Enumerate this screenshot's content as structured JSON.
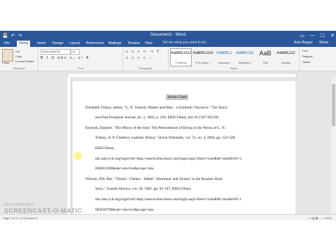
{
  "window": {
    "title": "Document1 - Word",
    "min": "—",
    "max": "☐",
    "close": "✕",
    "ribbon_opts": "▭"
  },
  "qat": {
    "save": "💾",
    "undo": "↶",
    "redo": "↷"
  },
  "tabs": [
    {
      "label": "File"
    },
    {
      "label": "Home"
    },
    {
      "label": "Insert"
    },
    {
      "label": "Design"
    },
    {
      "label": "Layout"
    },
    {
      "label": "References"
    },
    {
      "label": "Mailings"
    },
    {
      "label": "Review"
    },
    {
      "label": "View"
    }
  ],
  "tellme": "Tell me what you want to do...",
  "user": "Amy Burger",
  "share": "Share",
  "ribbon": {
    "clipboard": {
      "paste": "Paste",
      "cut": "Cut",
      "copy": "Copy",
      "painter": "Format Painter",
      "label": "Clipboard"
    },
    "font": {
      "name": "Times New Ro",
      "size": "12",
      "row": "B I U abc x₂ x² A",
      "label": "Font"
    },
    "paragraph": {
      "row1": "≡ ≡ ≡ ⇤ ⇥ ¶",
      "row2": "≡ ≡ ≡ ≡ ↕",
      "label": "Paragraph"
    },
    "styles": [
      {
        "sample": "AaBbCcDc",
        "name": "¶ Normal",
        "active": true
      },
      {
        "sample": "AaBbCcDc",
        "name": "¶ No Spac..."
      },
      {
        "sample": "AaBbCc",
        "name": "Heading 1"
      },
      {
        "sample": "AaBbCcE",
        "name": "Heading 2"
      },
      {
        "sample": "AaB",
        "name": "Title"
      },
      {
        "sample": "AaBbCcD",
        "name": "Subtitle"
      }
    ],
    "styles_label": "Styles",
    "editing": {
      "find": "Find",
      "replace": "Replace",
      "select": "Select",
      "label": "Editing"
    }
  },
  "document": {
    "heading": "Works Cited",
    "lines": [
      "Elizabeth Trahan, author. \"L. N. Tolstoj's Master and Man - a Symbolic Narrative.\" The Slavic",
      "and East European Journal, no. 3, 1963, p. 258. EBSCOhost, doi:10.2307/305336.",
      "Kiseyok, Damnie. \"The Mirror of the Soul: The Phenomenon of Dying in the Works of L. N.",
      "Tolstoy, A. P. Chekhov, Ladislav Klima.\" Slavia Orientalis, vol. 53, no. 4, 2004, pp. 521-528.",
      "EBSCOhost,",
      "doc.aim.ycls.org/login?url=http://search.ebscohost.com/login.aspx?direct=true&db=mzh&AN=2",
      "004632369&site=eds-live&scope=site.",
      "Nilsson, Nils Åke. \"Tolstoi - Chekov - Babel': 'Shortness' and 'Syntax' in the Russian Short",
      "Story.\" Scando-Slavica, vol. 28, 1982, pp. 91-107. EBSCOhost,",
      "doc.aim.ycls.org/login?url=http://search.ebscohost.com/login.aspx?direct=true&db=mzh&AN=1",
      "983019790&site=eds-live&scope=site."
    ]
  },
  "status": {
    "left": "Page 1 of 1   1 of 90 words   ☐",
    "right": "▭  ▤  ▦   —  +  100%"
  },
  "watermark": {
    "line1": "RECORDED WITH",
    "line2": "SCREENCAST-O-MATIC"
  }
}
